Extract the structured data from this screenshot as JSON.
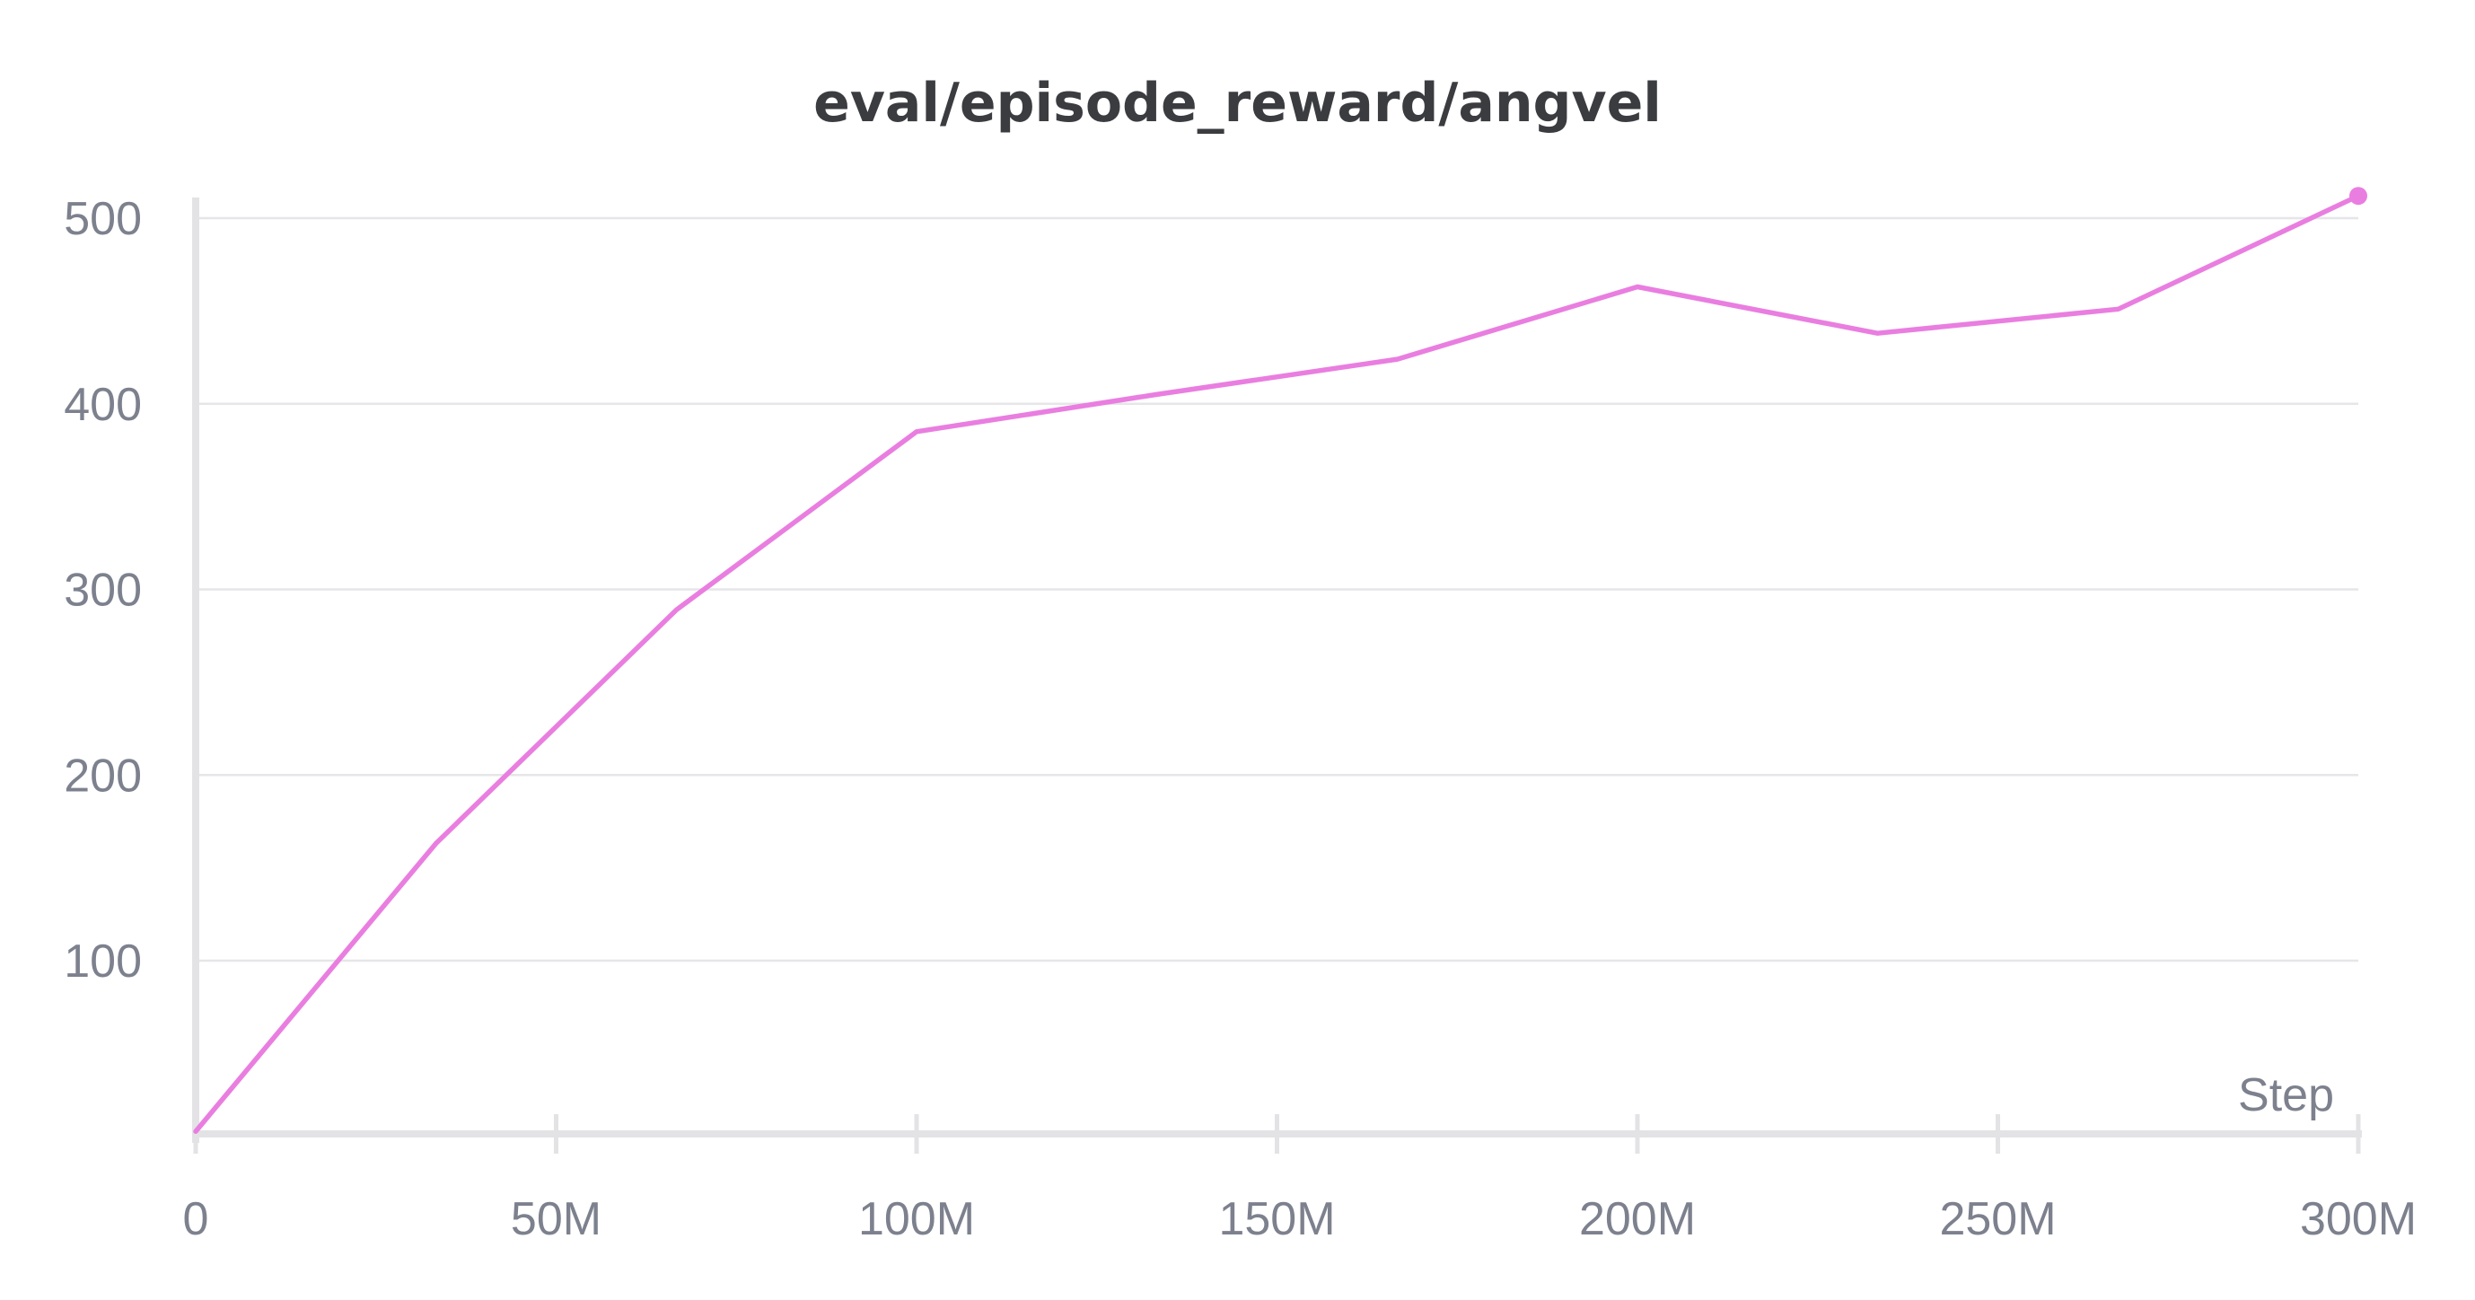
{
  "chart_data": {
    "type": "line",
    "title": "eval/episode_reward/angvel",
    "xlabel": "Step",
    "ylabel": "",
    "xlim": [
      0,
      300000000
    ],
    "ylim": [
      5,
      515
    ],
    "x_ticks": [
      {
        "value": 0,
        "label": "0"
      },
      {
        "value": 50000000,
        "label": "50M"
      },
      {
        "value": 100000000,
        "label": "100M"
      },
      {
        "value": 150000000,
        "label": "150M"
      },
      {
        "value": 200000000,
        "label": "200M"
      },
      {
        "value": 250000000,
        "label": "250M"
      },
      {
        "value": 300000000,
        "label": "300M"
      }
    ],
    "y_ticks": [
      {
        "value": 100,
        "label": "100"
      },
      {
        "value": 200,
        "label": "200"
      },
      {
        "value": 300,
        "label": "300"
      },
      {
        "value": 400,
        "label": "400"
      },
      {
        "value": 500,
        "label": "500"
      }
    ],
    "grid": true,
    "series": [
      {
        "color": "#e97ee0",
        "x": [
          0,
          33300000,
          66700000,
          100000000,
          133300000,
          166700000,
          200000000,
          233300000,
          266700000,
          300000000
        ],
        "y": [
          8,
          163,
          289,
          385,
          405,
          424,
          463,
          438,
          451,
          512
        ]
      }
    ]
  }
}
